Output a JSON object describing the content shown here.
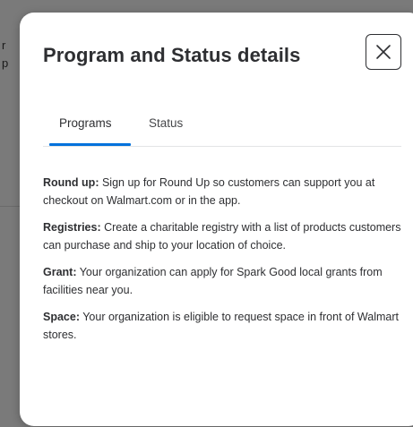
{
  "backdrop": {
    "line1": "r",
    "line2": "p"
  },
  "modal": {
    "title": "Program and Status details",
    "close_icon": "close-icon",
    "tabs": [
      {
        "label": "Programs",
        "selected": true
      },
      {
        "label": "Status",
        "selected": false
      }
    ],
    "accent_color": "#0071dc",
    "programs": [
      {
        "term": "Round up:",
        "description": " Sign up for Round Up so customers can support you at checkout on Walmart.com or in the app."
      },
      {
        "term": "Registries:",
        "description": " Create a charitable registry with a list of products customers can purchase and ship to your location of choice."
      },
      {
        "term": "Grant:",
        "description": " Your organization can apply for Spark Good local grants from facilities near you."
      },
      {
        "term": "Space:",
        "description": " Your organization is eligible to request space in front of Walmart stores."
      }
    ]
  }
}
